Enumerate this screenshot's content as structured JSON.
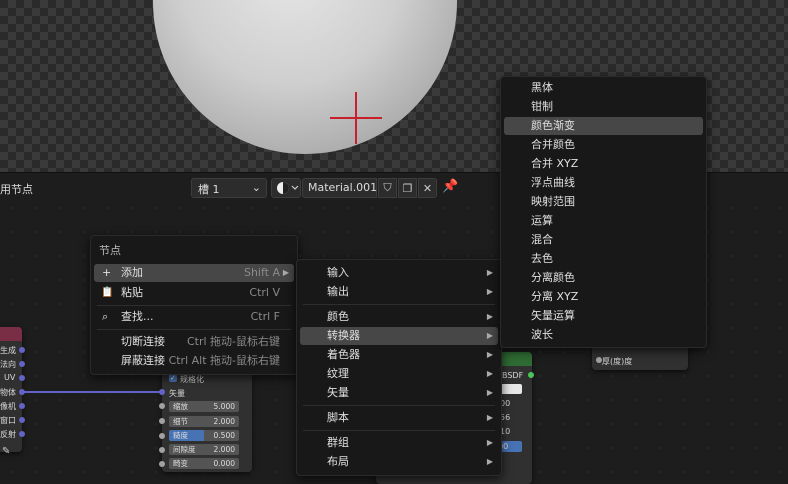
{
  "editor": {
    "title": "用节点",
    "slot": "槽 1",
    "material_name": "Material.001"
  },
  "left_node": {
    "labels": [
      "生成",
      "法向",
      "UV",
      "物体",
      "像机",
      "窗口",
      "反射"
    ]
  },
  "noise_node": {
    "normalize_label": "规格化",
    "vector_label": "矢量",
    "fields": [
      {
        "label": "缩放",
        "value": "5.000"
      },
      {
        "label": "细节",
        "value": "2.000"
      },
      {
        "label": "糙度",
        "value": "0.500"
      },
      {
        "label": "间隙度",
        "value": "2.000"
      },
      {
        "label": "畸变",
        "value": "0.000"
      }
    ]
  },
  "bsdf_node": {
    "header": "BSDF",
    "values": [
      "00",
      "56",
      "10",
      "00"
    ]
  },
  "right_node": {
    "rows": [
      "厚(度)度"
    ]
  },
  "node_menu": {
    "title": "节点",
    "items": [
      {
        "label": "添加",
        "shortcut": "Shift A"
      },
      {
        "label": "粘贴",
        "shortcut": "Ctrl V"
      },
      {
        "label": "查找...",
        "shortcut": "Ctrl F"
      },
      {
        "label": "切断连接",
        "shortcut": "Ctrl 拖动-鼠标右键"
      },
      {
        "label": "屏蔽连接",
        "shortcut": "Ctrl Alt 拖动-鼠标右键"
      }
    ]
  },
  "add_menu": {
    "items": [
      "输入",
      "输出",
      "颜色",
      "转换器",
      "着色器",
      "纹理",
      "矢量",
      "脚本",
      "群组",
      "布局"
    ]
  },
  "converter_menu": {
    "items": [
      "黑体",
      "钳制",
      "颜色渐变",
      "合并颜色",
      "合并 XYZ",
      "浮点曲线",
      "映射范围",
      "运算",
      "混合",
      "去色",
      "分离颜色",
      "分离 XYZ",
      "矢量运算",
      "波长"
    ]
  }
}
